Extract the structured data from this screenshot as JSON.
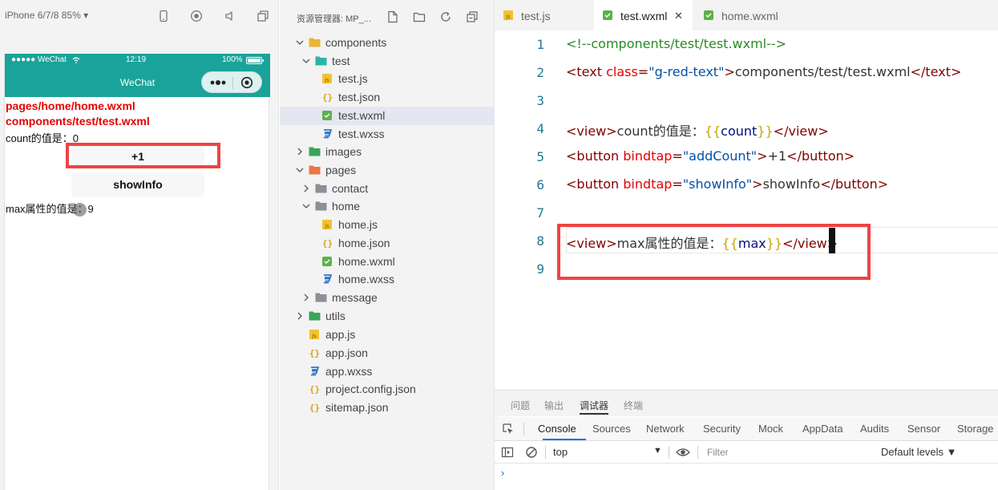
{
  "simulator": {
    "device": "iPhone 6/7/8 85% ▾",
    "status_bar": {
      "carrier": "●●●●● WeChat",
      "time": "12:19",
      "battery": "100%"
    },
    "nav_title": "WeChat",
    "content": {
      "page_path": "pages/home/home.wxml",
      "component_path": "components/test/test.wxml",
      "count_text": "count的值是：0",
      "plus_button": "+1",
      "showinfo_button": "showInfo",
      "max_text": "max属性的值是：9"
    }
  },
  "explorer": {
    "title": "资源管理器: MP_...",
    "tree": [
      {
        "label": "components",
        "depth": 0,
        "type": "folder-yellow",
        "expanded": true
      },
      {
        "label": "test",
        "depth": 1,
        "type": "folder-teal",
        "expanded": true
      },
      {
        "label": "test.js",
        "depth": 2,
        "type": "js"
      },
      {
        "label": "test.json",
        "depth": 2,
        "type": "json"
      },
      {
        "label": "test.wxml",
        "depth": 2,
        "type": "wxml",
        "selected": true
      },
      {
        "label": "test.wxss",
        "depth": 2,
        "type": "wxss"
      },
      {
        "label": "images",
        "depth": 0,
        "type": "folder-green",
        "expanded": false
      },
      {
        "label": "pages",
        "depth": 0,
        "type": "folder-orange",
        "expanded": true
      },
      {
        "label": "contact",
        "depth": 1,
        "type": "folder-gray",
        "expanded": false
      },
      {
        "label": "home",
        "depth": 1,
        "type": "folder-gray",
        "expanded": true
      },
      {
        "label": "home.js",
        "depth": 2,
        "type": "js"
      },
      {
        "label": "home.json",
        "depth": 2,
        "type": "json"
      },
      {
        "label": "home.wxml",
        "depth": 2,
        "type": "wxml"
      },
      {
        "label": "home.wxss",
        "depth": 2,
        "type": "wxss"
      },
      {
        "label": "message",
        "depth": 1,
        "type": "folder-gray",
        "expanded": false
      },
      {
        "label": "utils",
        "depth": 0,
        "type": "folder-green",
        "expanded": false
      },
      {
        "label": "app.js",
        "depth": 0,
        "type": "js"
      },
      {
        "label": "app.json",
        "depth": 0,
        "type": "json"
      },
      {
        "label": "app.wxss",
        "depth": 0,
        "type": "wxss"
      },
      {
        "label": "project.config.json",
        "depth": 0,
        "type": "json"
      },
      {
        "label": "sitemap.json",
        "depth": 0,
        "type": "json"
      }
    ]
  },
  "editor": {
    "tabs": [
      {
        "label": "test.js",
        "type": "js",
        "active": false
      },
      {
        "label": "test.wxml",
        "type": "wxml",
        "active": true
      },
      {
        "label": "home.wxml",
        "type": "wxml",
        "active": false
      }
    ],
    "close_glyph": "✕",
    "lines": [
      {
        "n": "1",
        "tokens": [
          [
            "c",
            "<!--components/test/test.wxml-->"
          ]
        ]
      },
      {
        "n": "2",
        "tokens": [
          [
            "t",
            "<text "
          ],
          [
            "a",
            "class"
          ],
          [
            "t",
            "="
          ],
          [
            "s",
            "\"g-red-text\""
          ],
          [
            "t",
            ">"
          ],
          [
            "p",
            "components/test/test.wxml"
          ],
          [
            "t",
            "</text>"
          ]
        ]
      },
      {
        "n": "3",
        "tokens": []
      },
      {
        "n": "4",
        "tokens": [
          [
            "t",
            "<view>"
          ],
          [
            "p",
            "count的值是："
          ],
          [
            "b",
            "{{"
          ],
          [
            "v",
            "count"
          ],
          [
            "b",
            "}}"
          ],
          [
            "t",
            "</view>"
          ]
        ]
      },
      {
        "n": "5",
        "tokens": [
          [
            "t",
            "<button "
          ],
          [
            "a",
            "bindtap"
          ],
          [
            "t",
            "="
          ],
          [
            "s",
            "\"addCount\""
          ],
          [
            "t",
            ">"
          ],
          [
            "p",
            "+1"
          ],
          [
            "t",
            "</button>"
          ]
        ]
      },
      {
        "n": "6",
        "tokens": [
          [
            "t",
            "<button "
          ],
          [
            "a",
            "bindtap"
          ],
          [
            "t",
            "="
          ],
          [
            "s",
            "\"showInfo\""
          ],
          [
            "t",
            ">"
          ],
          [
            "p",
            "showInfo"
          ],
          [
            "t",
            "</button>"
          ]
        ]
      },
      {
        "n": "7",
        "tokens": []
      },
      {
        "n": "8",
        "tokens": [
          [
            "t",
            "<view>"
          ],
          [
            "p",
            "max属性的值是："
          ],
          [
            "b",
            "{{"
          ],
          [
            "v",
            "max"
          ],
          [
            "b",
            "}}"
          ],
          [
            "t",
            "</view>"
          ]
        ]
      },
      {
        "n": "9",
        "tokens": []
      }
    ]
  },
  "devtools": {
    "top_tabs": [
      "问题",
      "输出",
      "调试器",
      "终端"
    ],
    "active_top_tab": "调试器",
    "panel_tabs": [
      "Console",
      "Sources",
      "Network",
      "Security",
      "Mock",
      "AppData",
      "Audits",
      "Sensor",
      "Storage"
    ],
    "active_panel_tab": "Console",
    "context": "top",
    "context_arrow": "▼",
    "filter_placeholder": "Filter",
    "levels": "Default levels ▼",
    "prompt": "›"
  },
  "colors": {
    "wechat_teal": "#1aa39a",
    "highlight_red": "#ee4444",
    "red_text": "#e50000"
  }
}
